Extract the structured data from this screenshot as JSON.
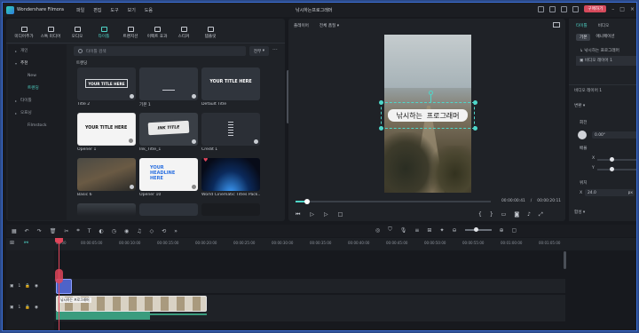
{
  "app": {
    "name": "Wondershare Filmora",
    "doc_title": "낚시하는프로그래머",
    "buy_label": "구매하기"
  },
  "menu": [
    "파일",
    "편집",
    "도구",
    "보기",
    "도움"
  ],
  "media_tabs": [
    {
      "label": "미디어추가",
      "icon": "media-icon"
    },
    {
      "label": "스톡 미디어",
      "icon": "stock-icon"
    },
    {
      "label": "오디오",
      "icon": "audio-icon"
    },
    {
      "label": "타이틀",
      "icon": "title-icon"
    },
    {
      "label": "트랜지션",
      "icon": "transition-icon"
    },
    {
      "label": "이펙트 효과",
      "icon": "effect-icon"
    },
    {
      "label": "스티커",
      "icon": "sticker-icon"
    },
    {
      "label": "템플릿",
      "icon": "template-icon"
    }
  ],
  "sidebar": [
    {
      "label": "개인",
      "type": "group"
    },
    {
      "label": "추천",
      "type": "group-open"
    },
    {
      "label": "New",
      "type": "sub"
    },
    {
      "label": "트렌딩",
      "type": "sub-active"
    },
    {
      "label": "타이틀",
      "type": "group"
    },
    {
      "label": "오프닝",
      "type": "group"
    },
    {
      "label": "Filmstock",
      "type": "sub"
    }
  ],
  "library": {
    "search_placeholder": "타이틀 검색",
    "filter_label": "전부",
    "section": "트렌딩",
    "tiles": [
      {
        "name": "Title 2",
        "text": "YOUR TITLE HERE"
      },
      {
        "name": "기본 1",
        "text": ""
      },
      {
        "name": "Default Title",
        "text": "YOUR TITLE HERE"
      },
      {
        "name": "Opener 1",
        "text": "YOUR TITLE HERE"
      },
      {
        "name": "Ink_Title_1",
        "text": "INK TITLE"
      },
      {
        "name": "Credit 1",
        "text": ""
      },
      {
        "name": "Basic 6",
        "text": ""
      },
      {
        "name": "Opener 10",
        "text": "YOUR HEADLINE HERE"
      },
      {
        "name": "World Cinematic Titles Pack...",
        "text": ""
      }
    ]
  },
  "player": {
    "quality_label": "플레이어",
    "zoom_label": "전체 품질",
    "title_text": "낚시하는 프로그래머",
    "current_time": "00:00:00:41",
    "total_time": "00:00:20:11",
    "progress": 0.05
  },
  "props": {
    "tabs": [
      "타이틀",
      "비디오"
    ],
    "subtabs": [
      "기본",
      "애니메이션"
    ],
    "tree": [
      "낚시하는 프로그래머",
      "비디오 레이어 1"
    ],
    "layer_title": "비디오 레이어 1",
    "transform_label": "변환",
    "rotate_label": "회전",
    "rotate_value": "0.00°",
    "scale_label": "배율",
    "x_label": "X",
    "y_label": "Y",
    "position_label": "위치",
    "pos_x_label": "X",
    "pos_x_value": "24.0",
    "pos_unit": "px",
    "blend_label": "합성"
  },
  "timeline": {
    "ticks": [
      "00:00",
      "00:00:05:00",
      "00:00:10:00",
      "00:00:15:00",
      "00:00:20:00",
      "00:00:25:00",
      "00:00:30:00",
      "00:00:35:00",
      "00:00:40:00",
      "00:00:45:00",
      "00:00:50:00",
      "00:00:55:00",
      "00:01:00:00",
      "00:01:05:00"
    ],
    "tracks": [
      {
        "label": "1"
      },
      {
        "label": "1"
      }
    ],
    "video_clip_label": "낚시하는 프로그래머"
  }
}
